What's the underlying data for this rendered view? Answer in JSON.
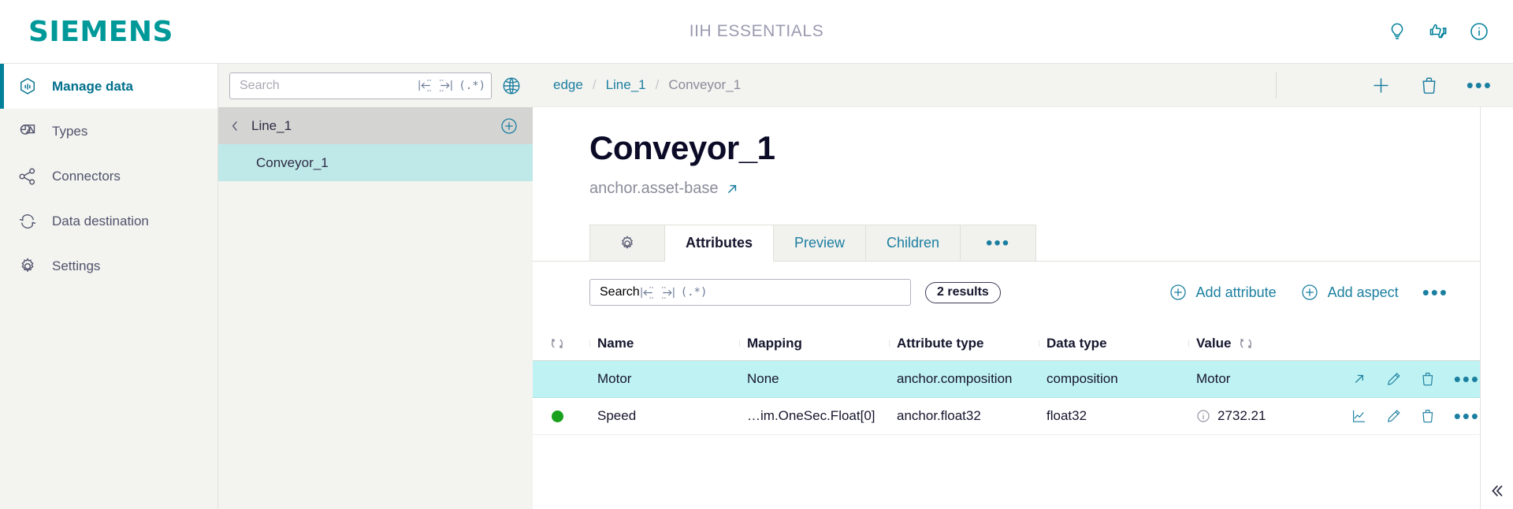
{
  "header": {
    "brand": "SIEMENS",
    "app_title": "IIH ESSENTIALS",
    "icons": [
      {
        "name": "lightbulb-icon",
        "label": "Tips"
      },
      {
        "name": "feedback-icon",
        "label": "Feedback"
      },
      {
        "name": "info-icon",
        "label": "Information"
      }
    ],
    "accent_color": "#009999"
  },
  "sidebar": {
    "items": [
      {
        "label": "Manage data",
        "icon": "hexagon-data-icon",
        "active": true
      },
      {
        "label": "Types",
        "icon": "types-icon",
        "active": false
      },
      {
        "label": "Connectors",
        "icon": "connectors-share-icon",
        "active": false
      },
      {
        "label": "Data destination",
        "icon": "sync-arrows-icon",
        "active": false
      },
      {
        "label": "Settings",
        "icon": "gear-icon",
        "active": false
      }
    ]
  },
  "tree": {
    "search": {
      "placeholder": "Search",
      "value": ""
    },
    "search_icons": [
      "match-start-icon",
      "match-end-icon",
      "regex-icon"
    ],
    "globe_icon": "globe-icon",
    "parent": {
      "label": "Line_1",
      "back_icon": "chevron-left-icon",
      "add_icon": "plus-circle-icon"
    },
    "children": [
      {
        "label": "Conveyor_1",
        "selected": true
      }
    ]
  },
  "breadcrumb": {
    "items": [
      {
        "label": "edge",
        "current": false
      },
      {
        "label": "Line_1",
        "current": false
      },
      {
        "label": "Conveyor_1",
        "current": true
      }
    ],
    "separator": "/",
    "actions": [
      {
        "name": "add-icon",
        "label": "Add"
      },
      {
        "name": "delete-icon",
        "label": "Delete"
      },
      {
        "name": "more-options-icon",
        "label": "More"
      }
    ]
  },
  "page": {
    "title": "Conveyor_1",
    "subtitle": "anchor.asset-base",
    "subtitle_link_icon": "external-link-icon"
  },
  "tabs": [
    {
      "label": "",
      "icon": "gear-icon",
      "active": false
    },
    {
      "label": "Attributes",
      "active": true
    },
    {
      "label": "Preview",
      "active": false
    },
    {
      "label": "Children",
      "active": false
    },
    {
      "label": "",
      "icon": "more-options-icon",
      "active": false
    }
  ],
  "table_toolbar": {
    "search": {
      "placeholder": "Search",
      "value": ""
    },
    "search_icons": [
      "match-start-icon",
      "match-end-icon",
      "regex-icon"
    ],
    "results_badge": "2 results",
    "add_attribute": "Add attribute",
    "add_aspect": "Add aspect",
    "more": "more-options-icon"
  },
  "table": {
    "columns": [
      "",
      "Name",
      "Mapping",
      "Attribute type",
      "Data type",
      "Value",
      ""
    ],
    "sort_icon": "sort-icon",
    "rows": [
      {
        "status": "",
        "name": "Motor",
        "mapping": "None",
        "attribute_type": "anchor.composition",
        "data_type": "composition",
        "value": "Motor",
        "value_info_icon": false,
        "selected": true,
        "actions": [
          "open-external-icon",
          "edit-icon",
          "delete-icon",
          "more-options-icon"
        ]
      },
      {
        "status": "online",
        "name": "Speed",
        "mapping": "…im.OneSec.Float[0]",
        "attribute_type": "anchor.float32",
        "data_type": "float32",
        "value": "2732.21",
        "value_info_icon": true,
        "selected": false,
        "actions": [
          "trend-chart-icon",
          "edit-icon",
          "delete-icon",
          "more-options-icon"
        ]
      }
    ]
  },
  "footer": {
    "collapse_icon": "chevron-double-left-icon"
  }
}
